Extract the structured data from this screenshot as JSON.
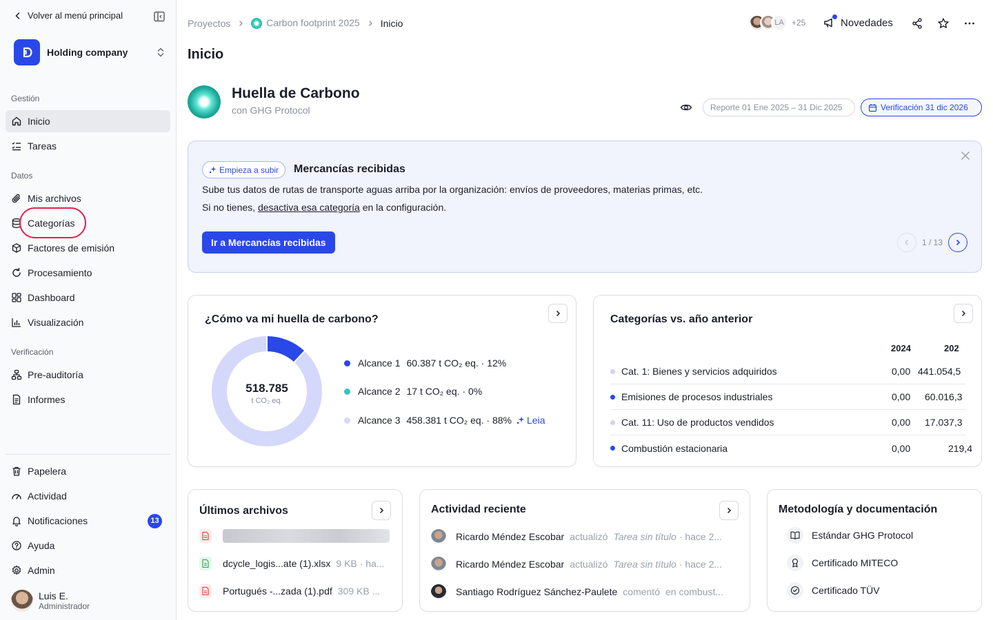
{
  "sidebar": {
    "back_label": "Volver al menú principal",
    "org_name": "Holding company",
    "sections": {
      "gestion": "Gestión",
      "datos": "Datos",
      "verificacion": "Verificación"
    },
    "items": {
      "inicio": "Inicio",
      "tareas": "Tareas",
      "mis_archivos": "Mis archivos",
      "categorias": "Categorías",
      "factores": "Factores de emisión",
      "procesamiento": "Procesamiento",
      "dashboard": "Dashboard",
      "visualizacion": "Visualización",
      "pre_auditoria": "Pre-auditoría",
      "informes": "Informes",
      "papelera": "Papelera",
      "actividad": "Actividad",
      "notificaciones": "Notificaciones",
      "ayuda": "Ayuda",
      "admin": "Admin"
    },
    "notifications_count": "13",
    "user": {
      "name": "Luis E.",
      "role": "Administrador"
    }
  },
  "topbar": {
    "breadcrumb": [
      "Proyectos",
      "Carbon footprint 2025",
      "Inicio"
    ],
    "avatar_initials": "LA",
    "avatar_more": "+25",
    "news_label": "Novedades"
  },
  "page": {
    "title": "Inicio"
  },
  "project": {
    "title": "Huella de Carbono",
    "subtitle": "con GHG Protocol",
    "period": "Reporte 01 Ene 2025 – 31 Dic 2025",
    "verification": "Verificación 31 dic 2026"
  },
  "banner": {
    "tag": "Empieza a subir",
    "title": "Mercancías recibidas",
    "text1": "Sube tus datos de rutas de transporte aguas arriba por la organización: envíos de proveedores, materias primas, etc.",
    "text2_pre": "Si no tienes, ",
    "text2_link": "desactiva esa categoría",
    "text2_post": " en la configuración.",
    "cta": "Ir a Mercancías recibidas",
    "pager": "1 / 13"
  },
  "footprint": {
    "title": "¿Cómo va mi huella de carbono?",
    "total": "518.785",
    "unit": "t CO₂ eq.",
    "leia_label": "Leia",
    "colors": {
      "alcance1": "#2a48e8",
      "alcance2": "#2ec7c0",
      "alcance3": "#d4d8fb"
    },
    "scopes": [
      {
        "name": "Alcance 1",
        "value": "60.387 t CO₂ eq. · 12%"
      },
      {
        "name": "Alcance 2",
        "value": "17 t CO₂ eq. · 0%"
      },
      {
        "name": "Alcance 3",
        "value": "458.381 t CO₂ eq. · 88%"
      }
    ],
    "shares": [
      0.12,
      0.0,
      0.88
    ]
  },
  "categories": {
    "title": "Categorías vs. año anterior",
    "col_2024": "2024",
    "col_next": "202",
    "rows": [
      {
        "name": "Cat. 1: Bienes y servicios adquiridos",
        "v2024": "0,00",
        "vnext": "441.054,5",
        "dot": "#cfd3f7"
      },
      {
        "name": "Emisiones de procesos industriales",
        "v2024": "0,00",
        "vnext": "60.016,3",
        "dot": "#2a48e8"
      },
      {
        "name": "Cat. 11: Uso de productos vendidos",
        "v2024": "0,00",
        "vnext": "17.037,3",
        "dot": "#cfd3f7"
      },
      {
        "name": "Combustión estacionaria",
        "v2024": "0,00",
        "vnext": "219,4",
        "dot": "#2a48e8"
      }
    ]
  },
  "files": {
    "title": "Últimos archivos",
    "rows": [
      {
        "name": "dcycle_logis...ate (1).xlsx",
        "meta": "9 KB · ha..."
      },
      {
        "name": "Portugués -...zada (1).pdf",
        "meta": "309 KB ..."
      }
    ]
  },
  "activity": {
    "title": "Actividad reciente",
    "rows": [
      {
        "user": "Ricardo Méndez Escobar",
        "verb": "actualizó",
        "object": "Tarea sin título",
        "time": "· hace 2..."
      },
      {
        "user": "Ricardo Méndez Escobar",
        "verb": "actualizó",
        "object": "Tarea sin título",
        "time": "· hace 2..."
      },
      {
        "user": "Santiago Rodríguez Sánchez-Paulete",
        "verb": "comentó",
        "object": "en combust...",
        "time": ""
      }
    ]
  },
  "docs": {
    "title": "Metodología y documentación",
    "rows": [
      "Estándar GHG Protocol",
      "Certificado MITECO",
      "Certificado TÜV"
    ]
  }
}
